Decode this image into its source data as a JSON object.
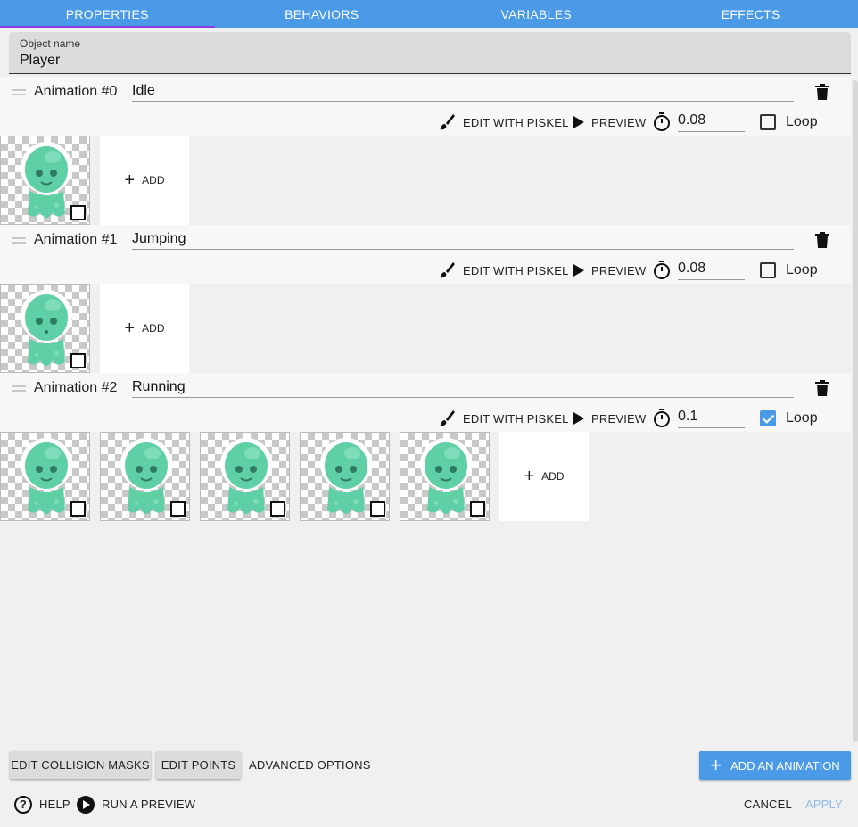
{
  "tabs": [
    "PROPERTIES",
    "BEHAVIORS",
    "VARIABLES",
    "EFFECTS"
  ],
  "object_name": {
    "label": "Object name",
    "value": "Player"
  },
  "controls": {
    "edit_label": "EDIT WITH PISKEL",
    "preview_label": "PREVIEW",
    "loop_label": "Loop",
    "add_label": "ADD"
  },
  "animations": [
    {
      "title": "Animation #0",
      "name": "Idle",
      "time": "0.08",
      "loop": false,
      "frames": 1
    },
    {
      "title": "Animation #1",
      "name": "Jumping",
      "time": "0.08",
      "loop": false,
      "frames": 1
    },
    {
      "title": "Animation #2",
      "name": "Running",
      "time": "0.1",
      "loop": true,
      "frames": 5
    }
  ],
  "footer": {
    "edit_collision": "EDIT COLLISION MASKS",
    "edit_points": "EDIT POINTS",
    "advanced": "ADVANCED OPTIONS",
    "add_animation": "ADD AN ANIMATION",
    "help": "HELP",
    "run_preview": "RUN A PREVIEW",
    "cancel": "CANCEL",
    "apply": "APPLY"
  },
  "colors": {
    "accent": "#4a9ae8",
    "tab_indicator": "#8a3ce0",
    "alien": "#5fcfa6"
  }
}
